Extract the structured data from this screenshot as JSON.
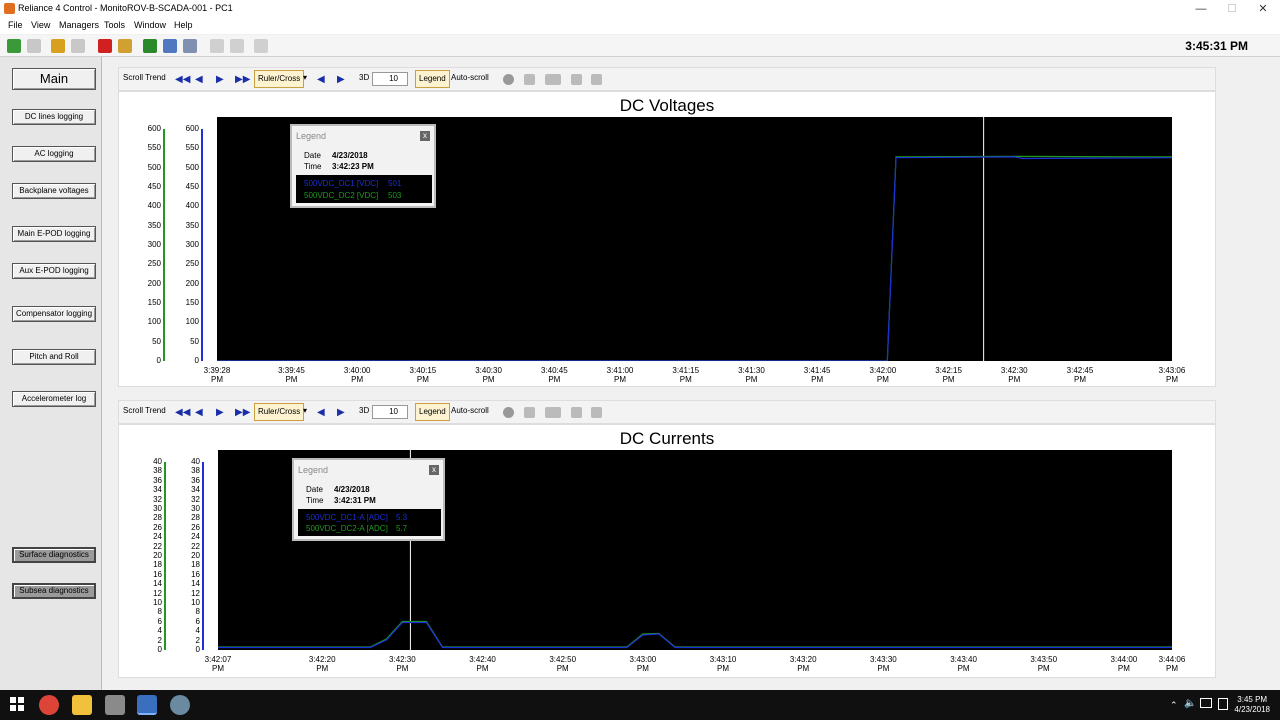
{
  "window": {
    "title": "Reliance 4 Control - MonitoROV-B-SCADA-001 - PC1",
    "minimize": "—",
    "maximize": "☐",
    "close": "✕"
  },
  "menu": [
    "File",
    "View",
    "Managers",
    "Tools",
    "Window",
    "Help"
  ],
  "toolbar": {
    "clock": "3:45:31 PM"
  },
  "sidebar": {
    "main": "Main",
    "items": [
      "DC lines logging",
      "AC logging",
      "Backplane voltages",
      "Main E-POD logging",
      "Aux E-POD logging",
      "Compensator logging",
      "Pitch and Roll",
      "Accelerometer log"
    ],
    "diagnostics": [
      "Surface diagnostics",
      "Subsea diagnostics"
    ]
  },
  "trend_toolbar": {
    "scroll": "Scroll Trend",
    "ruler": "Ruler/Cross",
    "threed": "3D",
    "depth": "10",
    "legend": "Legend",
    "autoscroll": "Auto-scroll"
  },
  "colors": {
    "series1": "#1c2fd8",
    "series2": "#1f9a1f",
    "plot_bg": "#000000",
    "panel_bg": "#ffffff"
  },
  "chart_data": [
    {
      "type": "line",
      "title": "DC Voltages",
      "ylim": [
        0,
        600
      ],
      "yticks": [
        "600",
        "550",
        "500",
        "450",
        "400",
        "350",
        "300",
        "250",
        "200",
        "150",
        "100",
        "50",
        "0"
      ],
      "xticks": [
        "3:39:28 PM",
        "3:39:45 PM",
        "3:40:00 PM",
        "3:40:15 PM",
        "3:40:30 PM",
        "3:40:45 PM",
        "3:41:00 PM",
        "3:41:15 PM",
        "3:41:30 PM",
        "3:41:45 PM",
        "3:42:00 PM",
        "3:42:15 PM",
        "3:42:30 PM",
        "3:42:45 PM",
        "3:43:06 PM"
      ],
      "x_start": "3:39:28 PM",
      "x_end": "3:43:06 PM",
      "cursor_time": "3:42:23 PM",
      "series": [
        {
          "name": "500VDC_DC1 [VDC]",
          "color": "#1c2fd8",
          "points": [
            [
              "3:39:28 PM",
              0
            ],
            [
              "3:42:01 PM",
              0
            ],
            [
              "3:42:03 PM",
              500
            ],
            [
              "3:42:30 PM",
              502
            ],
            [
              "3:42:32 PM",
              498
            ],
            [
              "3:43:06 PM",
              500
            ]
          ]
        },
        {
          "name": "500VDC_DC2 [VDC]",
          "color": "#1f9a1f",
          "points": [
            [
              "3:39:28 PM",
              0
            ],
            [
              "3:42:01 PM",
              0
            ],
            [
              "3:42:03 PM",
              502
            ],
            [
              "3:42:30 PM",
              503
            ],
            [
              "3:43:06 PM",
              502
            ]
          ]
        }
      ],
      "legend": {
        "header": "Legend",
        "close": "x",
        "date_label": "Date",
        "date": "4/23/2018",
        "time_label": "Time",
        "time": "3:42:23 PM",
        "entries": [
          {
            "name": "500VDC_DC1 [VDC]",
            "value": "501"
          },
          {
            "name": "500VDC_DC2 [VDC]",
            "value": "503"
          }
        ]
      }
    },
    {
      "type": "line",
      "title": "DC Currents",
      "ylim": [
        0,
        40
      ],
      "yticks": [
        "40",
        "38",
        "36",
        "34",
        "32",
        "30",
        "28",
        "26",
        "24",
        "22",
        "20",
        "18",
        "16",
        "14",
        "12",
        "10",
        "8",
        "6",
        "4",
        "2",
        "0"
      ],
      "xticks": [
        "3:42:07 PM",
        "3:42:20 PM",
        "3:42:30 PM",
        "3:42:40 PM",
        "3:42:50 PM",
        "3:43:00 PM",
        "3:43:10 PM",
        "3:43:20 PM",
        "3:43:30 PM",
        "3:43:40 PM",
        "3:43:50 PM",
        "3:44:00 PM",
        "3:44:06 PM"
      ],
      "x_start": "3:42:07 PM",
      "x_end": "3:44:06 PM",
      "cursor_time": "3:42:31 PM",
      "series": [
        {
          "name": "500VDC_DC1-A [ADC]",
          "color": "#1c2fd8",
          "points": [
            [
              "3:42:07 PM",
              0.5
            ],
            [
              "3:42:26 PM",
              0.5
            ],
            [
              "3:42:28 PM",
              2.0
            ],
            [
              "3:42:30 PM",
              5.5
            ],
            [
              "3:42:33 PM",
              5.5
            ],
            [
              "3:42:35 PM",
              0.5
            ],
            [
              "3:42:58 PM",
              0.5
            ],
            [
              "3:43:00 PM",
              3.0
            ],
            [
              "3:43:02 PM",
              3.2
            ],
            [
              "3:43:04 PM",
              0.5
            ],
            [
              "3:44:06 PM",
              0.5
            ]
          ]
        },
        {
          "name": "500VDC_DC2-A [ADC]",
          "color": "#1f9a1f",
          "points": [
            [
              "3:42:07 PM",
              0.6
            ],
            [
              "3:42:26 PM",
              0.6
            ],
            [
              "3:42:28 PM",
              2.2
            ],
            [
              "3:42:30 PM",
              5.7
            ],
            [
              "3:42:33 PM",
              5.7
            ],
            [
              "3:42:35 PM",
              0.6
            ],
            [
              "3:42:58 PM",
              0.6
            ],
            [
              "3:43:00 PM",
              3.2
            ],
            [
              "3:43:02 PM",
              3.3
            ],
            [
              "3:43:04 PM",
              0.6
            ],
            [
              "3:44:06 PM",
              0.6
            ]
          ]
        }
      ],
      "legend": {
        "header": "Legend",
        "close": "x",
        "date_label": "Date",
        "date": "4/23/2018",
        "time_label": "Time",
        "time": "3:42:31 PM",
        "entries": [
          {
            "name": "500VDC_DC1-A [ADC]",
            "value": "5.3"
          },
          {
            "name": "500VDC_DC2-A [ADC]",
            "value": "5.7"
          }
        ]
      }
    }
  ],
  "taskbar": {
    "time": "3:45 PM",
    "date": "4/23/2018"
  }
}
